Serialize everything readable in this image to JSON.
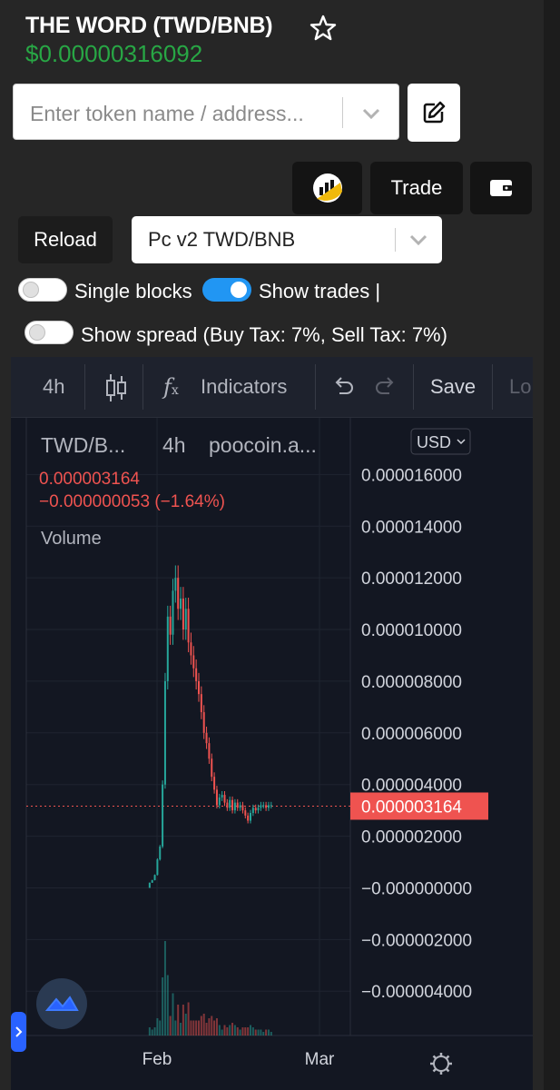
{
  "header": {
    "title": "THE WORD (TWD/BNB)",
    "price": "$0.00000316092"
  },
  "search": {
    "placeholder": "Enter token name / address..."
  },
  "buttons": {
    "trade": "Trade",
    "reload": "Reload"
  },
  "pair_select": {
    "value": "Pc v2 TWD/BNB"
  },
  "toggles": {
    "single_blocks": {
      "label": "Single blocks",
      "on": false
    },
    "show_trades": {
      "label": "Show trades |",
      "on": true
    },
    "show_spread": {
      "label": "Show spread (Buy Tax: 7%, Sell Tax: 7%)",
      "on": false
    }
  },
  "chart_toolbar": {
    "interval": "4h",
    "indicators": "Indicators",
    "save": "Save",
    "cut": "Lo"
  },
  "legend": {
    "symbol": "TWD/B...",
    "interval": "4h",
    "source": "poocoin.a...",
    "currency": "USD",
    "last": "0.000003164",
    "change": "−0.000000053 (−1.64%)",
    "volume_label": "Volume"
  },
  "colors": {
    "up": "#26a69a",
    "down": "#ef5350",
    "price_green": "#28a745",
    "toggle_on": "#2196f3",
    "chart_bg": "#131722"
  },
  "chart_data": {
    "type": "candlestick",
    "y_ticks": [
      "0.000016000",
      "0.000014000",
      "0.000012000",
      "0.000010000",
      "0.000008000",
      "0.000006000",
      "0.000004000",
      "0.000002000",
      "−0.000000000",
      "−0.000002000",
      "−0.000004000"
    ],
    "x_ticks": [
      "Feb",
      "Mar"
    ],
    "last_price_label": "0.000003164",
    "last_price": 3.164e-06,
    "ylim": [
      -4.8e-06,
      1.64e-05
    ],
    "price_series": [
      0.0,
      2e-07,
      3e-07,
      5e-07,
      1.1e-06,
      1.6e-06,
      4e-06,
      8e-06,
      1.05e-05,
      9.8e-06,
      1.15e-05,
      1.2e-05,
      1.08e-05,
      1.12e-05,
      1e-05,
      1.08e-05,
      9.5e-06,
      9e-06,
      8.5e-06,
      8e-06,
      7.5e-06,
      6.8e-06,
      6e-06,
      5.6e-06,
      5e-06,
      4.3e-06,
      3.8e-06,
      3.2e-06,
      3.5e-06,
      3.6e-06,
      3.3e-06,
      3.1e-06,
      3.4e-06,
      3e-06,
      3.3e-06,
      3.1e-06,
      3.2e-06,
      3e-06,
      2.8e-06,
      2.6e-06,
      2.9e-06,
      3.1e-06,
      3e-06,
      3.1e-06,
      3.2e-06,
      3.2e-06,
      3.1e-06,
      3.2e-06,
      3.2e-06
    ]
  }
}
